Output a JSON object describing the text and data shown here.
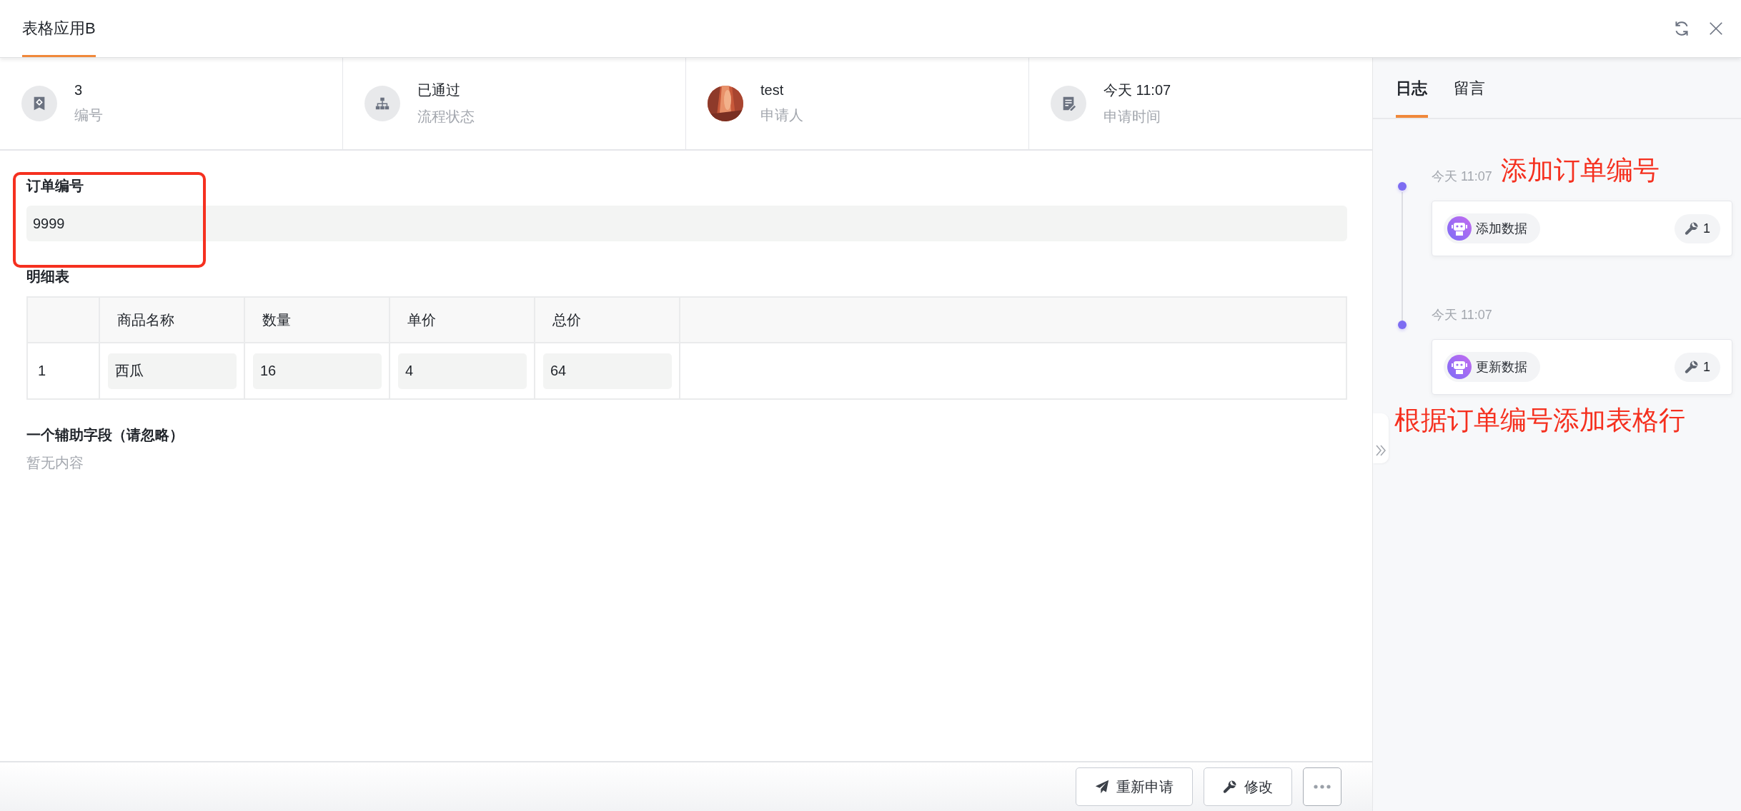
{
  "tabs": [
    {
      "label": "表格应用B",
      "selected": true
    }
  ],
  "info": [
    {
      "kind": "number",
      "value": "3",
      "label": "编号"
    },
    {
      "kind": "flow",
      "value": "已通过",
      "label": "流程状态"
    },
    {
      "kind": "avatar",
      "value": "test",
      "label": "申请人"
    },
    {
      "kind": "time",
      "value": "今天 11:07",
      "label": "申请时间"
    }
  ],
  "order_field": {
    "label": "订单编号",
    "value": "9999",
    "highlighted": true
  },
  "detail_table": {
    "title": "明细表",
    "columns": [
      "商品名称",
      "数量",
      "单价",
      "总价"
    ],
    "rows": [
      {
        "index": "1",
        "cells": [
          "西瓜",
          "16",
          "4",
          "64"
        ]
      }
    ]
  },
  "aux_field": {
    "label": "一个辅助字段（请忽略）",
    "empty_text": "暂无内容"
  },
  "footer_buttons": [
    {
      "kind": "resend",
      "label": "重新申请"
    },
    {
      "kind": "edit",
      "label": "修改"
    },
    {
      "kind": "more"
    }
  ],
  "side_tabs": [
    {
      "label": "日志",
      "selected": true
    },
    {
      "label": "留言",
      "selected": false
    }
  ],
  "log": [
    {
      "time": "今天 11:07",
      "action": "添加数据",
      "count": "1",
      "annotation": "添加订单编号"
    },
    {
      "time": "今天 11:07",
      "action": "更新数据",
      "count": "1",
      "annotation": "根据订单编号添加表格行"
    }
  ]
}
